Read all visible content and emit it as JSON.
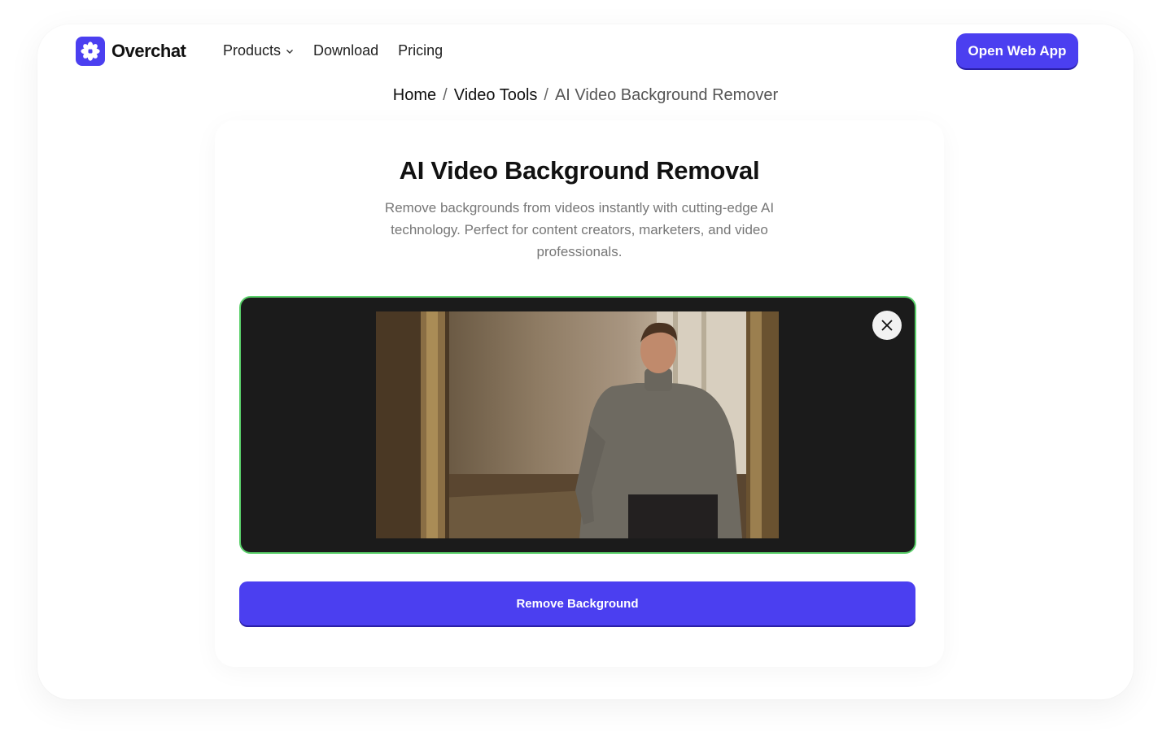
{
  "nav": {
    "brand": "Overchat",
    "menu": [
      {
        "label": "Products",
        "has_dropdown": true
      },
      {
        "label": "Download"
      },
      {
        "label": "Pricing"
      }
    ],
    "cta_label": "Open Web App"
  },
  "breadcrumb": {
    "items": [
      "Home",
      "Video Tools"
    ],
    "current": "AI Video Background Remover",
    "separator": "/"
  },
  "main": {
    "title": "AI Video Background Removal",
    "subtitle": "Remove backgrounds from videos instantly with cutting-edge AI technology. Perfect for content creators, marketers, and video professionals.",
    "action_label": "Remove Background"
  },
  "colors": {
    "accent": "#4b3ff0",
    "upload_border": "#5ad06a",
    "video_backdrop": "#1b1b1b"
  },
  "icons": {
    "logo": "asterisk-icon",
    "dropdown": "chevron-down-icon",
    "close": "close-icon"
  }
}
